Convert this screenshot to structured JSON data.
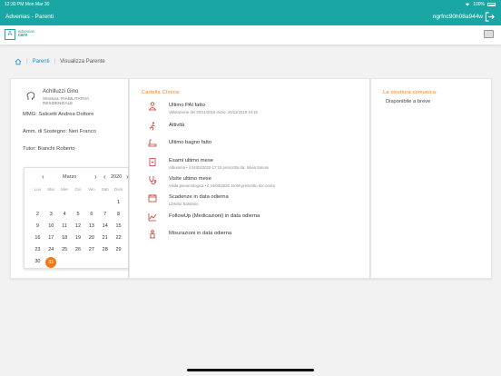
{
  "status_bar": {
    "time": "12:30 PM  Mon Mar 30",
    "battery": "100%"
  },
  "app_header": {
    "title": "Advenias - Parenti",
    "user": "ngrfnc90h08a944w"
  },
  "logo": {
    "mark": "A",
    "line1": "advenias",
    "line2": "care"
  },
  "breadcrumb": {
    "parent": "Parenti",
    "current": "Visualizza Parente"
  },
  "patient": {
    "name": "Achilluzzi Gino",
    "structure": "Struttura: RIABILITATIVA RESIDENZIALE",
    "mmg": "MMG: Salicetti Andrea Dottore",
    "support": "Amm. di Sostegno: Neri Franco",
    "tutor": "Tutor: Bianchi Roberto"
  },
  "calendar": {
    "month": "Marzo",
    "year": "2020",
    "weekdays": [
      "Lun",
      "Mar",
      "Mer",
      "Gio",
      "Ven",
      "Sab",
      "Dom"
    ],
    "selected_day": "31",
    "days": [
      "",
      "",
      "",
      "",
      "",
      "",
      "1",
      "2",
      "3",
      "4",
      "5",
      "6",
      "7",
      "8",
      "9",
      "10",
      "11",
      "12",
      "13",
      "14",
      "15",
      "16",
      "17",
      "18",
      "19",
      "20",
      "21",
      "22",
      "23",
      "24",
      "25",
      "26",
      "27",
      "28",
      "29",
      "30",
      "31"
    ]
  },
  "clinic": {
    "title": "Cartella Clinica:",
    "items": [
      {
        "icon": "pai-icon",
        "label": "Ultimo PAI fatto",
        "sub": "Valutazione del 20/11/2019 inizio: 20/11/2019 10:15"
      },
      {
        "icon": "activity-icon",
        "label": "Attività",
        "sub": ""
      },
      {
        "icon": "bath-icon",
        "label": "Ultimo bagno fatto",
        "sub": ""
      },
      {
        "icon": "exam-icon",
        "label": "Esami ultimo mese",
        "sub": "Albumina • il 24/03/2020 17:15 prescritto da: Silvia Simoni"
      },
      {
        "icon": "stethoscope-icon",
        "label": "Visite ultimo mese",
        "sub": "Visita pneumologica • il 24/03/2020 15:08 prescritto da: cesco"
      },
      {
        "icon": "calendar-icon",
        "label": "Scadenze in data odierna",
        "sub": "Libretto Sanitario"
      },
      {
        "icon": "medication-icon",
        "label": "FollowUp (Medicazioni) in data odierna",
        "sub": ""
      },
      {
        "icon": "measure-icon",
        "label": "Misurazioni in data odierna",
        "sub": ""
      }
    ]
  },
  "communications": {
    "title": "La struttura comunica:",
    "text": "Disponibile a breve"
  },
  "colors": {
    "primary": "#1aa7a3",
    "accent": "#f07a1a",
    "link": "#1a8fd9"
  }
}
